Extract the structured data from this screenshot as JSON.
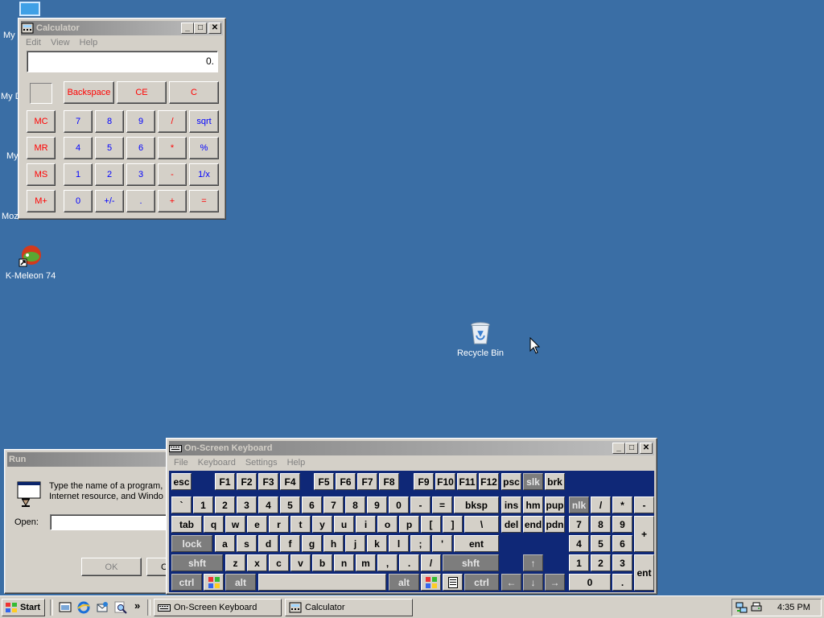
{
  "desktop": {
    "icons": [
      {
        "label": "My"
      },
      {
        "label": "My D"
      },
      {
        "label": "My"
      },
      {
        "label": "Moz"
      },
      {
        "label": "K-Meleon 74"
      },
      {
        "label": "Recycle Bin"
      }
    ]
  },
  "calculator": {
    "title": "Calculator",
    "menu": [
      "Edit",
      "View",
      "Help"
    ],
    "display": "0.",
    "top_buttons": [
      "Backspace",
      "CE",
      "C"
    ],
    "memory_buttons": [
      "MC",
      "MR",
      "MS",
      "M+"
    ],
    "rows": [
      [
        "7",
        "8",
        "9",
        "/",
        "sqrt"
      ],
      [
        "4",
        "5",
        "6",
        "*",
        "%"
      ],
      [
        "1",
        "2",
        "3",
        "-",
        "1/x"
      ],
      [
        "0",
        "+/-",
        ".",
        "+",
        "="
      ]
    ]
  },
  "run_dialog": {
    "title": "Run",
    "description_line1": "Type the name of a program,",
    "description_line2": "Internet resource, and Windo",
    "open_label": "Open:",
    "ok_label": "OK",
    "cancel_partial": "C"
  },
  "osk": {
    "title": "On-Screen Keyboard",
    "menu": [
      "File",
      "Keyboard",
      "Settings",
      "Help"
    ],
    "row1": [
      "esc",
      "F1",
      "F2",
      "F3",
      "F4",
      "F5",
      "F6",
      "F7",
      "F8",
      "F9",
      "F10",
      "F11",
      "F12",
      "psc",
      "slk",
      "brk"
    ],
    "row2": [
      "`",
      "1",
      "2",
      "3",
      "4",
      "5",
      "6",
      "7",
      "8",
      "9",
      "0",
      "-",
      "=",
      "bksp",
      "ins",
      "hm",
      "pup",
      "nlk",
      "/",
      "*",
      "-"
    ],
    "row3": [
      "tab",
      "q",
      "w",
      "e",
      "r",
      "t",
      "y",
      "u",
      "i",
      "o",
      "p",
      "[",
      "]",
      "\\",
      "del",
      "end",
      "pdn",
      "7",
      "8",
      "9",
      "+"
    ],
    "row4": [
      "lock",
      "a",
      "s",
      "d",
      "f",
      "g",
      "h",
      "j",
      "k",
      "l",
      ";",
      "'",
      "ent",
      "4",
      "5",
      "6"
    ],
    "row5": [
      "shft",
      "z",
      "x",
      "c",
      "v",
      "b",
      "n",
      "m",
      ",",
      ".",
      "/",
      "shft",
      "↑",
      "1",
      "2",
      "3",
      "ent"
    ],
    "row6": [
      "ctrl",
      "alt",
      "alt",
      "ctrl",
      "←",
      "↓",
      "→",
      "0",
      "."
    ]
  },
  "taskbar": {
    "start_label": "Start",
    "buttons": [
      "On-Screen Keyboard",
      "Calculator"
    ],
    "chevron": "»",
    "clock": "4:35 PM"
  },
  "colors": {
    "desktop": "#3a6ea5",
    "osk_panel": "#0f2877",
    "calc_red": "#ff0000",
    "calc_blue": "#0000ff"
  },
  "icons": [
    "computer-icon",
    "documents-icon",
    "network-icon",
    "mozilla-icon",
    "kmeleon-icon",
    "recycle-bin-icon",
    "calculator-app-icon",
    "keyboard-app-icon",
    "run-app-icon",
    "windows-logo-icon",
    "menu-key-icon",
    "mouse-cursor-icon",
    "show-desktop-icon",
    "ie-icon",
    "outlook-icon",
    "search-icon",
    "network-tray-icon",
    "printer-tray-icon"
  ]
}
